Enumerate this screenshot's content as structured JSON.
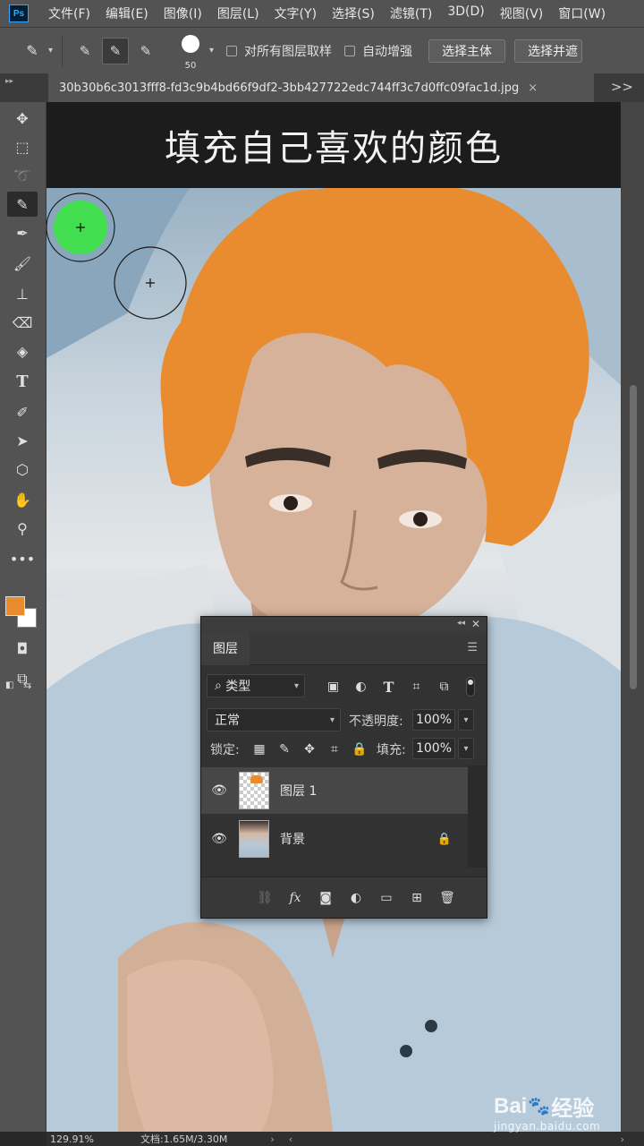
{
  "menu": [
    "文件(F)",
    "编辑(E)",
    "图像(I)",
    "图层(L)",
    "文字(Y)",
    "选择(S)",
    "滤镜(T)",
    "3D(D)",
    "视图(V)",
    "窗口(W)"
  ],
  "app_logo": "Ps",
  "options": {
    "brush_size": "50",
    "sample_all_layers": "对所有图层取样",
    "auto_enhance": "自动增强",
    "select_subject": "选择主体",
    "select_and_mask": "选择并遮"
  },
  "tab": {
    "filename": "30b30b6c3013fff8-fd3c9b4bd66f9df2-3bb427722edc744ff3c7d0ffc09fac1d.jpg",
    "close": "×",
    "more": ">>"
  },
  "canvas": {
    "caption": "填充自己喜欢的颜色"
  },
  "colors": {
    "foreground": "#e98c30",
    "background": "#ffffff",
    "fill_hair": "#e98c30",
    "cursor_green": "#3ee04a"
  },
  "layers_panel": {
    "tab_label": "图层",
    "filter_kind": "类型",
    "blend_mode": "正常",
    "opacity_label": "不透明度:",
    "opacity_value": "100%",
    "lock_label": "锁定:",
    "fill_label": "填充:",
    "fill_value": "100%",
    "layers": [
      {
        "name": "图层 1",
        "selected": true,
        "locked": false
      },
      {
        "name": "背景",
        "selected": false,
        "locked": true
      }
    ]
  },
  "status": {
    "zoom": "129.91%",
    "doc": "文档:1.65M/3.30M"
  },
  "watermark": {
    "logo_left": "Bai",
    "logo_right": "经验",
    "url": "jingyan.baidu.com"
  }
}
